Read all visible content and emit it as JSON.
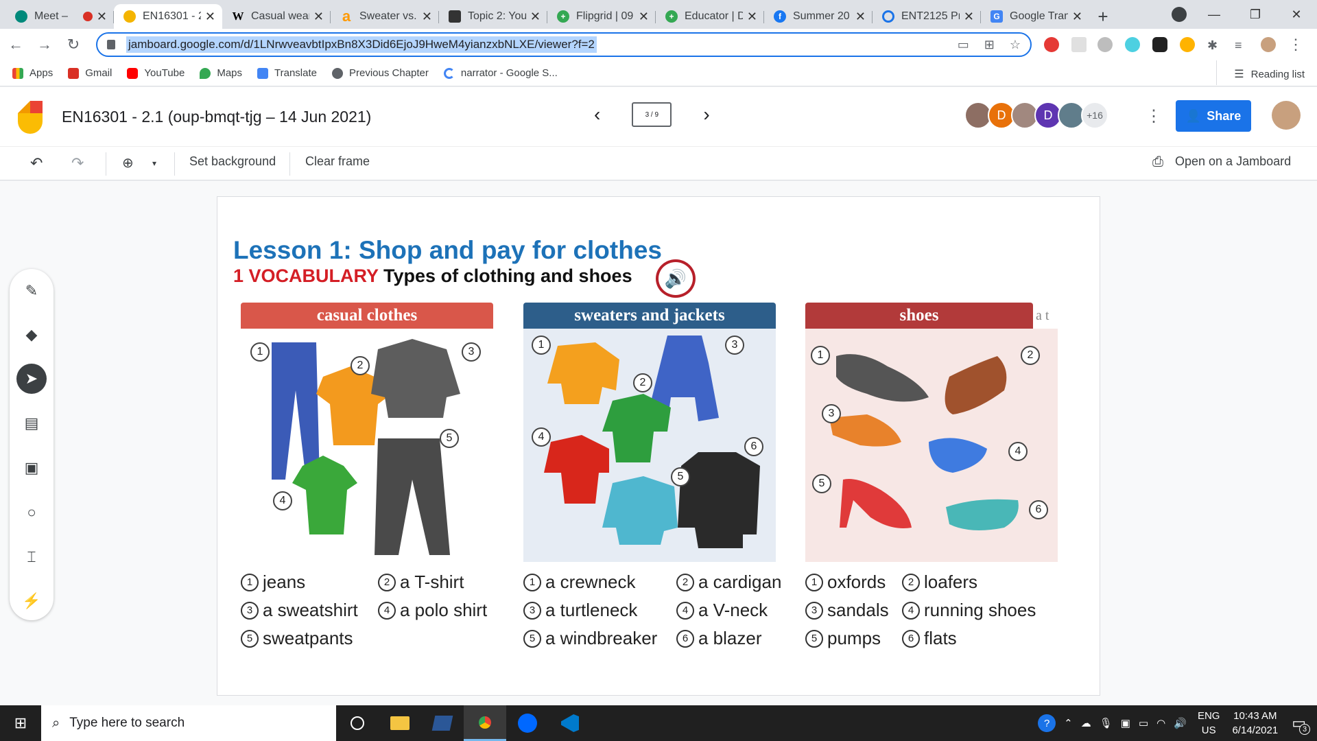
{
  "browser": {
    "tabs": [
      {
        "title": "Meet –",
        "favicon_color": "#00897b",
        "active": false
      },
      {
        "title": "EN16301 - 2",
        "favicon_color": "#f4b400",
        "active": true
      },
      {
        "title": "Casual wear",
        "favicon_color": "#ffffff",
        "active": false
      },
      {
        "title": "Sweater vs.",
        "favicon_color": "#ff9900",
        "active": false
      },
      {
        "title": "Topic 2: You",
        "favicon_color": "#333333",
        "active": false
      },
      {
        "title": "Flipgrid | 09",
        "favicon_color": "#34a853",
        "active": false
      },
      {
        "title": "Educator | D",
        "favicon_color": "#34a853",
        "active": false
      },
      {
        "title": "Summer 20",
        "favicon_color": "#1877f2",
        "active": false
      },
      {
        "title": "ENT2125 Pr",
        "favicon_color": "#1a73e8",
        "active": false
      },
      {
        "title": "Google Tran",
        "favicon_color": "#4285f4",
        "active": false
      }
    ],
    "url": "jamboard.google.com/d/1LNrwveavbtIpxBn8X3Did6EjoJ9HweM4yianzxbNLXE/viewer?f=2",
    "bookmarks": [
      {
        "label": "Apps",
        "color": "#ea4335"
      },
      {
        "label": "Gmail",
        "color": "#d93025"
      },
      {
        "label": "YouTube",
        "color": "#ff0000"
      },
      {
        "label": "Maps",
        "color": "#34a853"
      },
      {
        "label": "Translate",
        "color": "#4285f4"
      },
      {
        "label": "Previous Chapter",
        "color": "#5f6368"
      },
      {
        "label": "narrator - Google S...",
        "color": "#4285f4"
      }
    ],
    "reading_list": "Reading list"
  },
  "jamboard": {
    "title": "EN16301 - 2.1 (oup-bmqt-tjg – 14 Jun 2021)",
    "frame_indicator": "3 / 9",
    "avatars": [
      {
        "letter": "",
        "color": "#8d6e63"
      },
      {
        "letter": "D",
        "color": "#e8710a"
      },
      {
        "letter": "",
        "color": "#a1887f"
      },
      {
        "letter": "D",
        "color": "#5e35b1"
      },
      {
        "letter": "",
        "color": "#607d8b"
      }
    ],
    "more_count": "+16",
    "share_label": "Share",
    "toolbar": {
      "set_background": "Set background",
      "clear_frame": "Clear frame",
      "open_on_jamboard": "Open on a Jamboard"
    }
  },
  "lesson": {
    "title": "Lesson 1: Shop and pay for clothes",
    "section_number": "1 VOCABULARY",
    "section_title": "Types of clothing and shoes",
    "categories": [
      {
        "label": "casual clothes",
        "color": "#d9574a"
      },
      {
        "label": "sweaters and jackets",
        "color": "#2d5e8a"
      },
      {
        "label": "shoes",
        "color": "#b23a3a"
      }
    ],
    "overflow_text": "a t",
    "vocab": {
      "casual": [
        {
          "n": "1",
          "w": "jeans"
        },
        {
          "n": "2",
          "w": "a T-shirt"
        },
        {
          "n": "3",
          "w": "a sweatshirt"
        },
        {
          "n": "4",
          "w": "a polo shirt"
        },
        {
          "n": "5",
          "w": "sweatpants"
        }
      ],
      "sweaters": [
        {
          "n": "1",
          "w": "a crewneck"
        },
        {
          "n": "2",
          "w": "a cardigan"
        },
        {
          "n": "3",
          "w": "a turtleneck"
        },
        {
          "n": "4",
          "w": "a V-neck"
        },
        {
          "n": "5",
          "w": "a windbreaker"
        },
        {
          "n": "6",
          "w": "a blazer"
        }
      ],
      "shoes": [
        {
          "n": "1",
          "w": "oxfords"
        },
        {
          "n": "2",
          "w": "loafers"
        },
        {
          "n": "3",
          "w": "sandals"
        },
        {
          "n": "4",
          "w": "running shoes"
        },
        {
          "n": "5",
          "w": "pumps"
        },
        {
          "n": "6",
          "w": "flats"
        }
      ]
    },
    "picture_numbers": {
      "casual": [
        "1",
        "2",
        "3",
        "4",
        "5"
      ],
      "sweaters": [
        "1",
        "2",
        "3",
        "4",
        "5",
        "6"
      ],
      "shoes": [
        "1",
        "2",
        "3",
        "4",
        "5",
        "6"
      ]
    }
  },
  "taskbar": {
    "search_placeholder": "Type here to search",
    "language": "ENG",
    "region": "US",
    "time": "10:43 AM",
    "date": "6/14/2021",
    "notification_count": "3"
  }
}
